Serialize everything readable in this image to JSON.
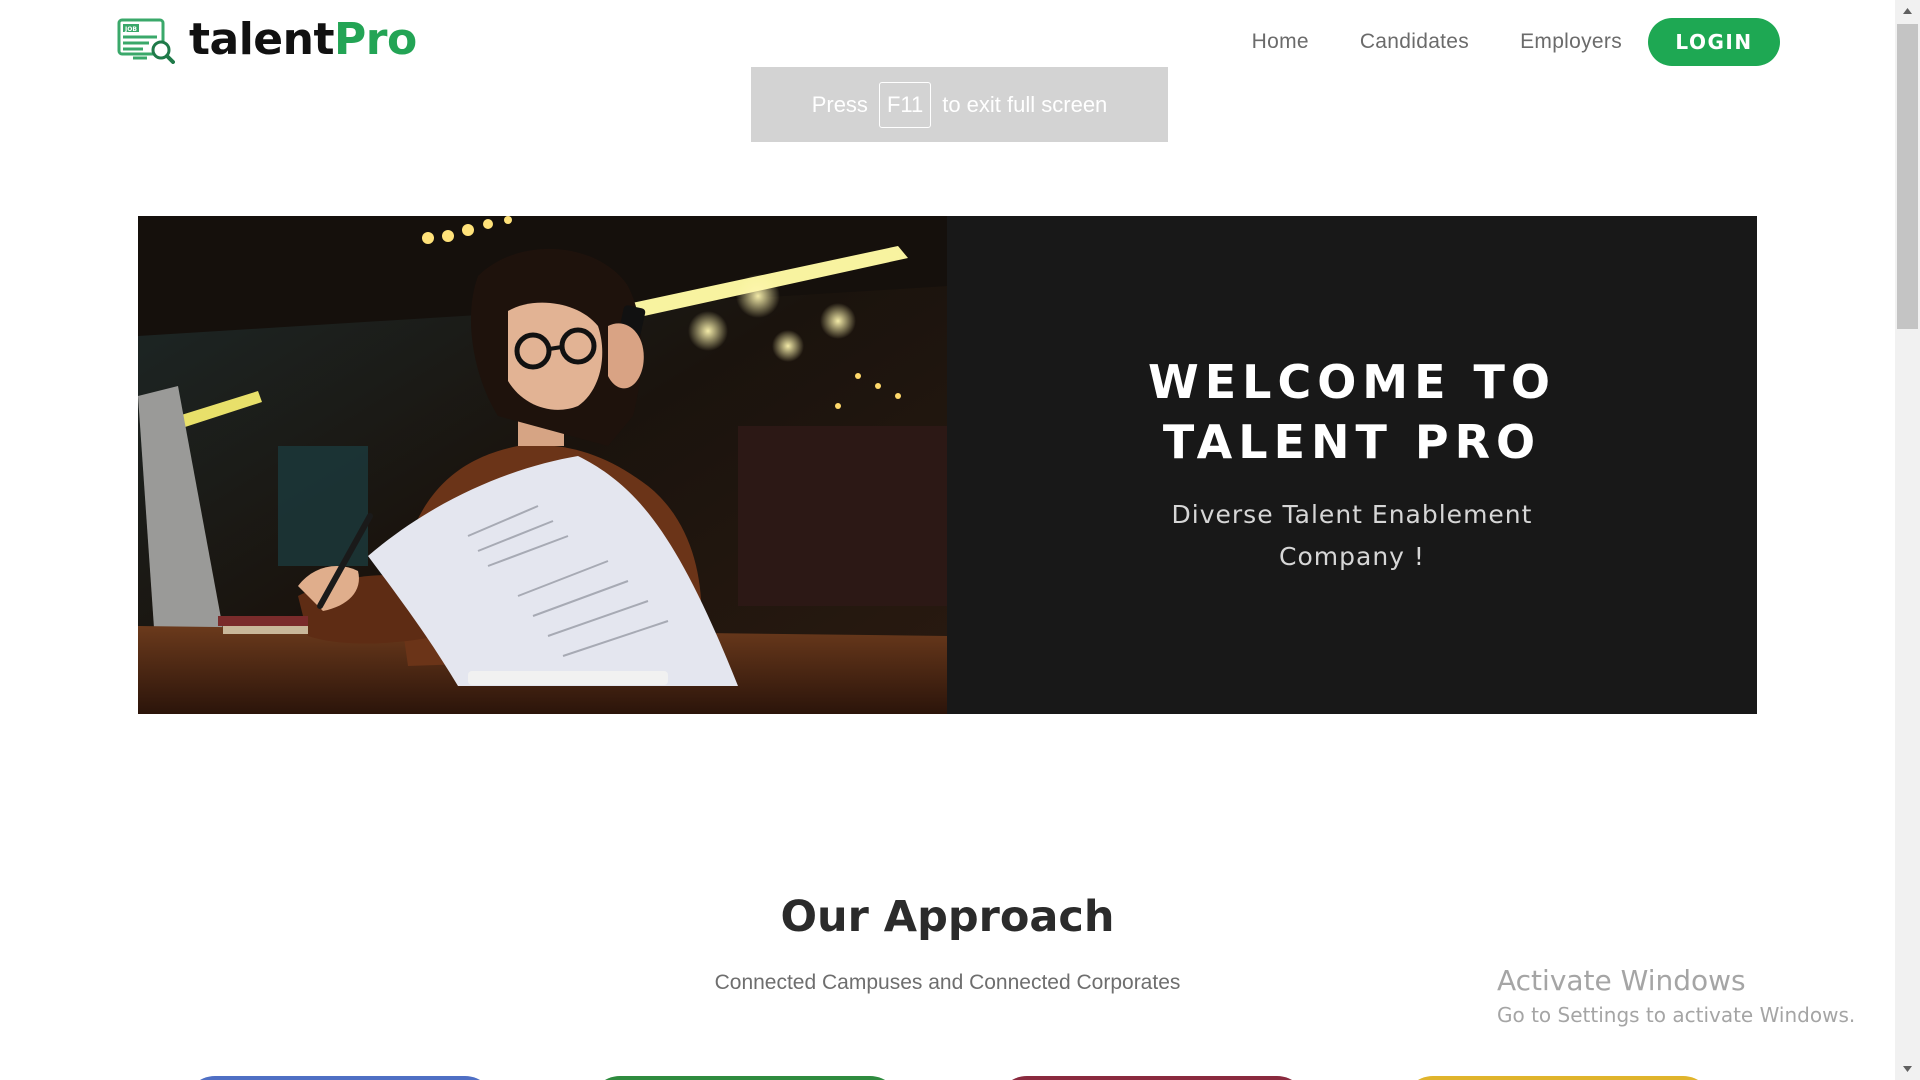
{
  "brand": {
    "name_part1": "talent",
    "name_part2": "Pro",
    "icon_label": "JOB",
    "green": "#23a455"
  },
  "nav": {
    "items": [
      {
        "label": "Home"
      },
      {
        "label": "Candidates"
      },
      {
        "label": "Employers"
      }
    ],
    "login_label": "LOGIN"
  },
  "fullscreen_notice": {
    "before": "Press",
    "key": "F11",
    "after": "to exit full screen"
  },
  "hero": {
    "title_line1": "WELCOME TO",
    "title_line2": "TALENT PRO",
    "subtitle_line1": "Diverse Talent Enablement",
    "subtitle_line2": "Company !",
    "image_alt": "woman-reviewing-documents-on-phone"
  },
  "approach": {
    "title": "Our Approach",
    "subtitle": "Connected Campuses and Connected Corporates",
    "card_colors": [
      "#4f6fc4",
      "#2e8b3e",
      "#8a2a3e",
      "#e0b42c"
    ]
  },
  "windows_watermark": {
    "line1": "Activate Windows",
    "line2": "Go to Settings to activate Windows."
  }
}
